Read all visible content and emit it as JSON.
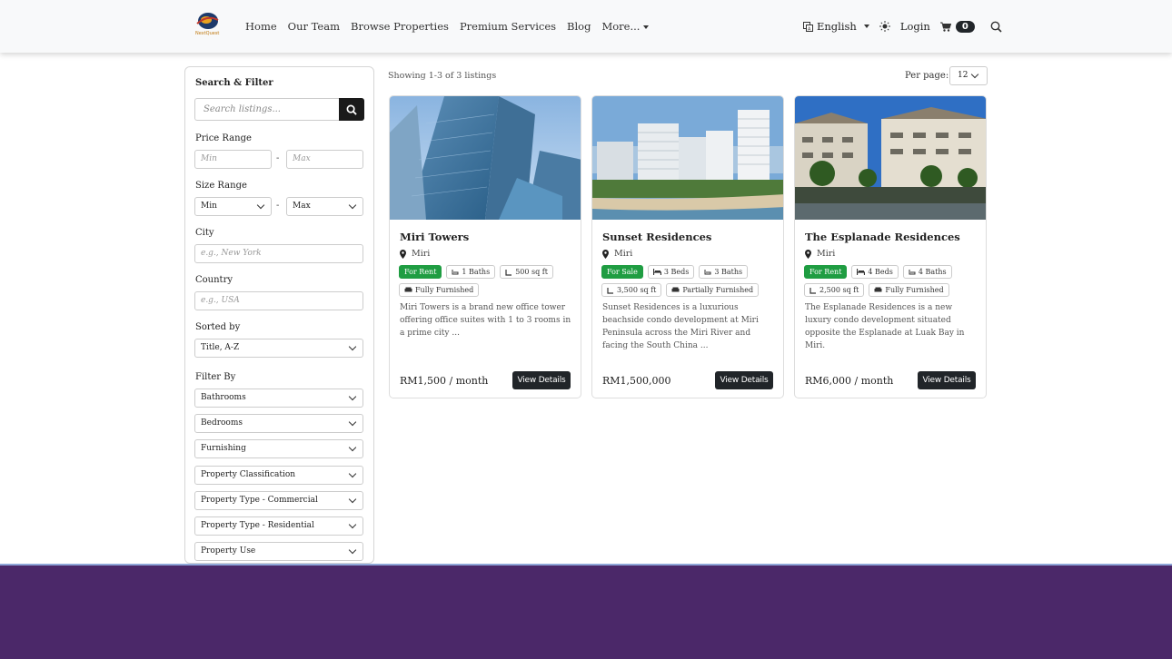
{
  "nav": {
    "brand": "NextQuest",
    "links": [
      "Home",
      "Our Team",
      "Browse Properties",
      "Premium Services",
      "Blog",
      "More..."
    ],
    "language": "English",
    "login": "Login",
    "cart_count": "0",
    "icons": [
      "translate-icon",
      "sun-icon",
      "cart-icon",
      "search-icon"
    ]
  },
  "sidebar": {
    "title": "Search & Filter",
    "search_placeholder": "Search listings...",
    "price_label": "Price Range",
    "price_min": "Min",
    "price_max": "Max",
    "size_label": "Size Range",
    "size_min": "Min",
    "size_max": "Max",
    "city_label": "City",
    "city_placeholder": "e.g., New York",
    "country_label": "Country",
    "country_placeholder": "e.g., USA",
    "sort_label": "Sorted by",
    "sort_value": "Title, A-Z",
    "filter_label": "Filter By",
    "filters": [
      "Bathrooms",
      "Bedrooms",
      "Furnishing",
      "Property Classification",
      "Property Type - Commercial",
      "Property Type - Residential",
      "Property Use"
    ]
  },
  "main": {
    "showing": "Showing 1-3 of 3 listings",
    "per_page_label": "Per page:",
    "per_page_value": "12",
    "view_label": "View Details"
  },
  "listings": [
    {
      "title": "Miri Towers",
      "location": "Miri",
      "status": "For Rent",
      "row1": [
        "1 Baths",
        "500 sq ft"
      ],
      "row2": [
        "Fully Furnished"
      ],
      "description": "Miri Towers is a brand new office tower offering office suites with 1 to 3 rooms in a prime city ...",
      "price": "RM1,500 / month"
    },
    {
      "title": "Sunset Residences",
      "location": "Miri",
      "status": "For Sale",
      "row1": [
        "3 Beds",
        "3 Baths"
      ],
      "row2": [
        "3,500 sq ft",
        "Partially Furnished"
      ],
      "description": "Sunset Residences is a luxurious beachside condo development at Miri Peninsula across the Miri River and facing the South China ...",
      "price": "RM1,500,000"
    },
    {
      "title": "The Esplanade Residences",
      "location": "Miri",
      "status": "For Rent",
      "row1": [
        "4 Beds",
        "4 Baths"
      ],
      "row2": [
        "2,500 sq ft",
        "Fully Furnished"
      ],
      "description": "The Esplanade Residences is a new luxury condo development situated opposite the Esplanade at Luak Bay in Miri.",
      "price": "RM6,000 / month"
    }
  ],
  "colors": {
    "tag_green": "#1f9d42",
    "button_dark": "#212529",
    "footer": "#4b2869"
  }
}
